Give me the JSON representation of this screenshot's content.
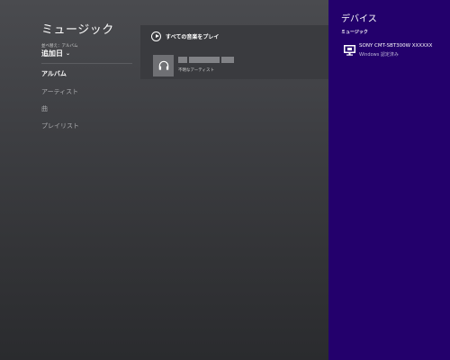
{
  "app": {
    "title": "ミュージック",
    "sort": {
      "caption": "並べ替え：アルバム",
      "selected": "追加日"
    },
    "nav": [
      {
        "label": "アルバム",
        "active": true
      },
      {
        "label": "アーティスト",
        "active": false
      },
      {
        "label": "曲",
        "active": false
      },
      {
        "label": "プレイリスト",
        "active": false
      }
    ],
    "play_all_label": "すべての音楽をプレイ",
    "album": {
      "artist": "不明なアーティスト"
    }
  },
  "devices_pane": {
    "title": "デバイス",
    "section": "ミュージック",
    "device": {
      "name": "SONY CMT-SBT300W XXXXXX",
      "status": "Windows 認定済み"
    }
  },
  "colors": {
    "charm_background": "#23006c",
    "app_background": "#3e3f43"
  },
  "icons": {
    "play": "play-circle-icon",
    "album_art": "headphones-icon",
    "device": "display-device-icon",
    "sort": "chevron-down-icon"
  }
}
